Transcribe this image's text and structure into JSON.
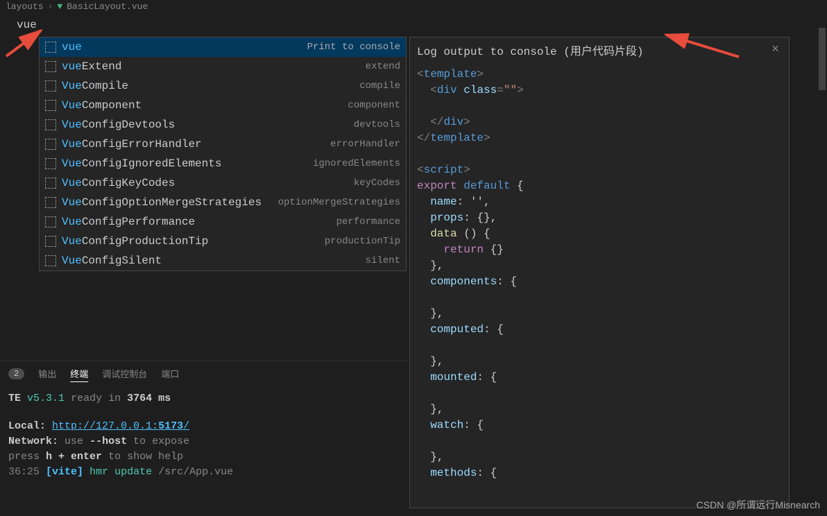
{
  "breadcrumb": {
    "folder": "layouts",
    "file": "BasicLayout.vue"
  },
  "editor": {
    "typed": "vue"
  },
  "suggestions": [
    {
      "prefix": "vue",
      "rest": "",
      "detail": "Print to console",
      "selected": true
    },
    {
      "prefix": "vue",
      "rest": "Extend",
      "detail": "extend"
    },
    {
      "prefix": "Vue",
      "rest": "Compile",
      "detail": "compile"
    },
    {
      "prefix": "Vue",
      "rest": "Component",
      "detail": "component"
    },
    {
      "prefix": "Vue",
      "rest": "ConfigDevtools",
      "detail": "devtools"
    },
    {
      "prefix": "Vue",
      "rest": "ConfigErrorHandler",
      "detail": "errorHandler"
    },
    {
      "prefix": "Vue",
      "rest": "ConfigIgnoredElements",
      "detail": "ignoredElements"
    },
    {
      "prefix": "Vue",
      "rest": "ConfigKeyCodes",
      "detail": "keyCodes"
    },
    {
      "prefix": "Vue",
      "rest": "ConfigOptionMergeStrategies",
      "detail": "optionMergeStrategies"
    },
    {
      "prefix": "Vue",
      "rest": "ConfigPerformance",
      "detail": "performance"
    },
    {
      "prefix": "Vue",
      "rest": "ConfigProductionTip",
      "detail": "productionTip"
    },
    {
      "prefix": "Vue",
      "rest": "ConfigSilent",
      "detail": "silent"
    }
  ],
  "doc": {
    "title": "Log output to console (用户代码片段)",
    "code_lines": [
      {
        "t": "tag-open",
        "parts": [
          "<",
          "template",
          ">"
        ]
      },
      {
        "t": "tag-open-attr",
        "indent": "  ",
        "parts": [
          "<",
          "div",
          " ",
          "class",
          "=",
          "\"\"",
          ">"
        ]
      },
      {
        "t": "blank"
      },
      {
        "t": "tag-close",
        "indent": "  ",
        "parts": [
          "</",
          "div",
          ">"
        ]
      },
      {
        "t": "tag-close",
        "parts": [
          "</",
          "template",
          ">"
        ]
      },
      {
        "t": "blank"
      },
      {
        "t": "tag-open",
        "parts": [
          "<",
          "script",
          ">"
        ]
      },
      {
        "t": "export",
        "parts": [
          "export",
          " ",
          "default",
          " {"
        ]
      },
      {
        "t": "prop",
        "indent": "  ",
        "key": "name",
        "after": ": '',"
      },
      {
        "t": "prop",
        "indent": "  ",
        "key": "props",
        "after": ": {},"
      },
      {
        "t": "fn",
        "indent": "  ",
        "key": "data",
        "after": " () {"
      },
      {
        "t": "return",
        "indent": "    ",
        "text": "return {}"
      },
      {
        "t": "plain",
        "indent": "  ",
        "text": "},"
      },
      {
        "t": "prop",
        "indent": "  ",
        "key": "components",
        "after": ": {"
      },
      {
        "t": "blank"
      },
      {
        "t": "plain",
        "indent": "  ",
        "text": "},"
      },
      {
        "t": "prop",
        "indent": "  ",
        "key": "computed",
        "after": ": {"
      },
      {
        "t": "blank"
      },
      {
        "t": "plain",
        "indent": "  ",
        "text": "},"
      },
      {
        "t": "prop",
        "indent": "  ",
        "key": "mounted",
        "after": ": {"
      },
      {
        "t": "blank"
      },
      {
        "t": "plain",
        "indent": "  ",
        "text": "},"
      },
      {
        "t": "prop",
        "indent": "  ",
        "key": "watch",
        "after": ": {"
      },
      {
        "t": "blank"
      },
      {
        "t": "plain",
        "indent": "  ",
        "text": "},"
      },
      {
        "t": "prop",
        "indent": "  ",
        "key": "methods",
        "after": ": {"
      }
    ]
  },
  "terminal": {
    "badge": "2",
    "tabs": [
      "输出",
      "终端",
      "调试控制台",
      "端口"
    ],
    "active_tab": 1,
    "lines": {
      "vite_label": "TE",
      "vite_version": "v5.3.1",
      "ready_text": "ready in",
      "ready_ms": "3764 ms",
      "local_label": "Local:",
      "local_url_prefix": "http://127.0.0.1:",
      "local_url_port": "5173",
      "local_url_suffix": "/",
      "network_label": "Network:",
      "network_hint1": "use",
      "network_flag": "--host",
      "network_hint2": "to expose",
      "help_prefix": "press",
      "help_keys": "h + enter",
      "help_suffix": "to show help",
      "time": "36:25",
      "vite_tag": "[vite]",
      "hmr": "hmr update",
      "hmr_path": "/src/App.vue"
    }
  },
  "watermark": "CSDN @所谓远行Misnearch"
}
